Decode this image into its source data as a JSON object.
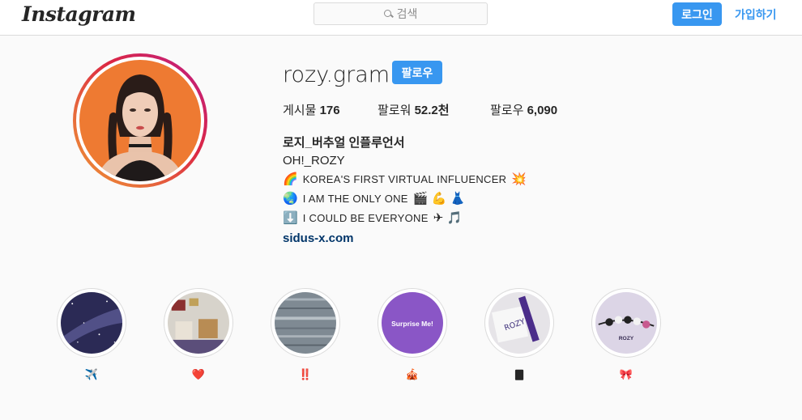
{
  "header": {
    "logo_text": "Instagram",
    "search_placeholder": "검색",
    "login_label": "로그인",
    "signup_label": "가입하기"
  },
  "profile": {
    "username": "rozy.gram",
    "follow_label": "팔로우",
    "stats": {
      "posts_label": "게시물",
      "posts_value": "176",
      "followers_label": "팔로워",
      "followers_value": "52.2천",
      "following_label": "팔로우",
      "following_value": "6,090"
    },
    "full_name": "로지_버추얼 인플루언서",
    "bio": [
      {
        "emoji_before": "",
        "text": "OH!_ROZY",
        "emoji_after": ""
      },
      {
        "emoji_before": "🌈",
        "text": "KOREA'S FIRST VIRTUAL INFLUENCER",
        "emoji_after": "💥"
      },
      {
        "emoji_before": "🌏",
        "text": "I AM THE ONLY ONE",
        "emoji_after": "🎬 💪 👗"
      },
      {
        "emoji_before": "⬇️",
        "text": "I COULD BE EVERYONE",
        "emoji_after": "✈ 🎵"
      }
    ],
    "website": "sidus-x.com"
  },
  "highlights": [
    {
      "label": "✈️",
      "icon": "galaxy"
    },
    {
      "label": "❤️",
      "icon": "room"
    },
    {
      "label": "‼️",
      "icon": "static-noise"
    },
    {
      "label": "🎪",
      "icon": "surprise-me",
      "image_text": "Surprise Me!"
    },
    {
      "label": "🀫",
      "icon": "rozy-paper",
      "image_text": "ROZY"
    },
    {
      "label": "🎀",
      "icon": "rozy-beads",
      "image_text": "ROZY"
    }
  ],
  "colors": {
    "accent": "#3897f0",
    "link": "#003569",
    "background": "#fafafa",
    "avatar_background": "#ee7a32"
  }
}
